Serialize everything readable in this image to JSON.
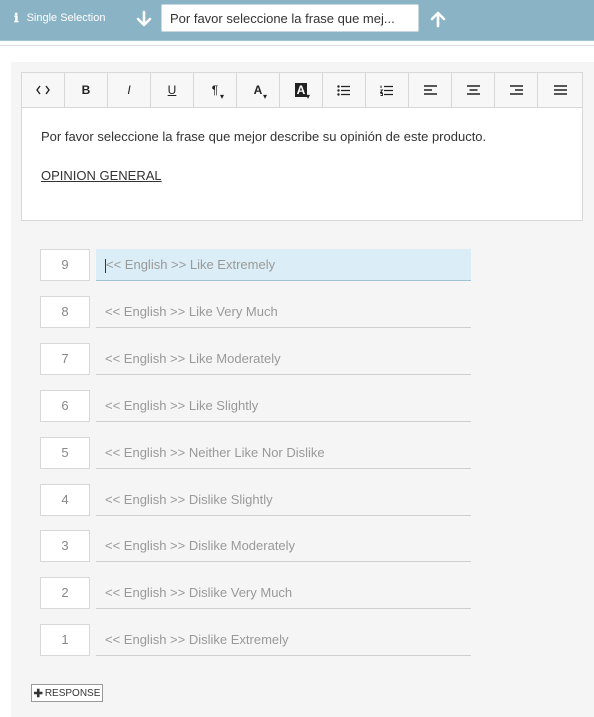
{
  "topbar": {
    "question_type": "Single Selection",
    "question_text": "Por favor seleccione la frase que mej..."
  },
  "editor": {
    "toolbar": [
      {
        "name": "code",
        "label": "<>"
      },
      {
        "name": "bold",
        "label": "B"
      },
      {
        "name": "italic",
        "label": "I"
      },
      {
        "name": "underline",
        "label": "U"
      },
      {
        "name": "paragraph",
        "label": "¶"
      },
      {
        "name": "font-color",
        "label": "A"
      },
      {
        "name": "highlight",
        "label": "A"
      },
      {
        "name": "bullet-list",
        "label": "☰"
      },
      {
        "name": "numbered-list",
        "label": "☰"
      },
      {
        "name": "align-left",
        "label": "≡"
      },
      {
        "name": "align-center",
        "label": "≡"
      },
      {
        "name": "align-right",
        "label": "≡"
      },
      {
        "name": "justify",
        "label": "≡"
      }
    ],
    "paragraph": "Por favor seleccione la frase que mejor describe su opinión de este producto.",
    "subheading": "OPINION GENERAL"
  },
  "responses": [
    {
      "value": "9",
      "label": "<< English >> Like Extremely",
      "active": true
    },
    {
      "value": "8",
      "label": "<< English >> Like Very Much"
    },
    {
      "value": "7",
      "label": "<< English >> Like Moderately"
    },
    {
      "value": "6",
      "label": "<< English >> Like Slightly"
    },
    {
      "value": "5",
      "label": "<< English >> Neither Like Nor Dislike"
    },
    {
      "value": "4",
      "label": "<< English >> Dislike Slightly"
    },
    {
      "value": "3",
      "label": "<< English >> Dislike Moderately"
    },
    {
      "value": "2",
      "label": "<< English >> Dislike Very Much"
    },
    {
      "value": "1",
      "label": "<< English >> Dislike Extremely"
    }
  ],
  "add_button": {
    "label": "RESPONSE"
  }
}
